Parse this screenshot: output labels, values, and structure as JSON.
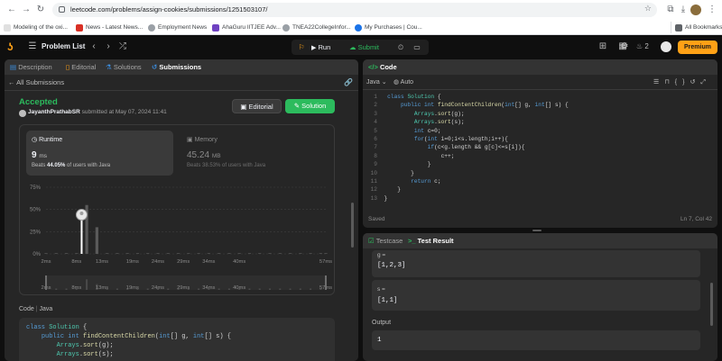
{
  "browser": {
    "url": "leetcode.com/problems/assign-cookies/submissions/1251503107/",
    "bookmarks": [
      {
        "label": "Modeling of the oxi...",
        "color": "#e0e0e0"
      },
      {
        "label": "News - Latest News...",
        "color": "#d93025"
      },
      {
        "label": "Employment News",
        "color": "#9aa0a6"
      },
      {
        "label": "AhaGuru IITJEE Adv...",
        "color": "#6f42c1"
      },
      {
        "label": "TNEA22CollegeInfor...",
        "color": "#9aa0a6"
      },
      {
        "label": "My Purchases | Cou...",
        "color": "#1a73e8"
      }
    ],
    "all_bookmarks": "All Bookmarks"
  },
  "nav": {
    "problem_list": "Problem List",
    "run": "Run",
    "submit": "Submit",
    "streak_count": "2",
    "premium": "Premium"
  },
  "left": {
    "tabs": [
      "Description",
      "Editorial",
      "Solutions",
      "Submissions"
    ],
    "all_submissions": "All Submissions",
    "status": "Accepted",
    "username": "JayanthPrathabSR",
    "submitted_text": "submitted at May 07, 2024 11:41",
    "editorial_btn": "Editorial",
    "solution_btn": "Solution",
    "runtime_label": "Runtime",
    "runtime_value": "9",
    "runtime_unit": "ms",
    "runtime_beats": "Beats",
    "runtime_pct": "44.05%",
    "runtime_beats_suffix": "of users with Java",
    "memory_label": "Memory",
    "memory_value": "45.24",
    "memory_unit": "MB",
    "memory_beats": "Beats 38.53% of users with Java",
    "code_label": "Code",
    "code_lang": "Java",
    "code_preview": [
      "class Solution {",
      "    public int findContentChildren(int[] g, int[] s) {",
      "        Arrays.sort(g);",
      "        Arrays.sort(s);"
    ]
  },
  "chart_data": {
    "type": "bar",
    "y_ticks": [
      "75%",
      "50%",
      "25%",
      "0%"
    ],
    "ylim": [
      0,
      75
    ],
    "x_ticks": [
      "2ms",
      "8ms",
      "13ms",
      "19ms",
      "24ms",
      "29ms",
      "34ms",
      "40ms",
      "57ms"
    ],
    "x": [
      2,
      4,
      6,
      8,
      10,
      12,
      14,
      16,
      18,
      20,
      22,
      24,
      26,
      28,
      30,
      32,
      34,
      36,
      38,
      40,
      42,
      44,
      46,
      48,
      50,
      52,
      54,
      56,
      57
    ],
    "values": [
      1,
      1,
      1,
      1,
      55,
      30,
      1,
      1,
      1,
      1,
      1,
      1,
      1,
      1,
      1,
      1,
      1,
      1,
      1,
      1,
      1,
      1,
      1,
      1,
      1,
      1,
      1,
      1,
      1
    ],
    "highlight_x": 9,
    "highlight_value": 44.05
  },
  "code": {
    "title": "Code",
    "lang": "Java",
    "mode": "Auto",
    "saved": "Saved",
    "position": "Ln 7, Col 42"
  },
  "test": {
    "tab1": "Testcase",
    "tab2": "Test Result",
    "g_label": "g =",
    "g_value": "[1,2,3]",
    "s_label": "s =",
    "s_value": "[1,1]",
    "output_label": "Output",
    "output_value": "1"
  },
  "colors": {
    "accepted": "#2cbb5d",
    "accent": "#ffa116",
    "link_blue": "#3c8dde"
  }
}
